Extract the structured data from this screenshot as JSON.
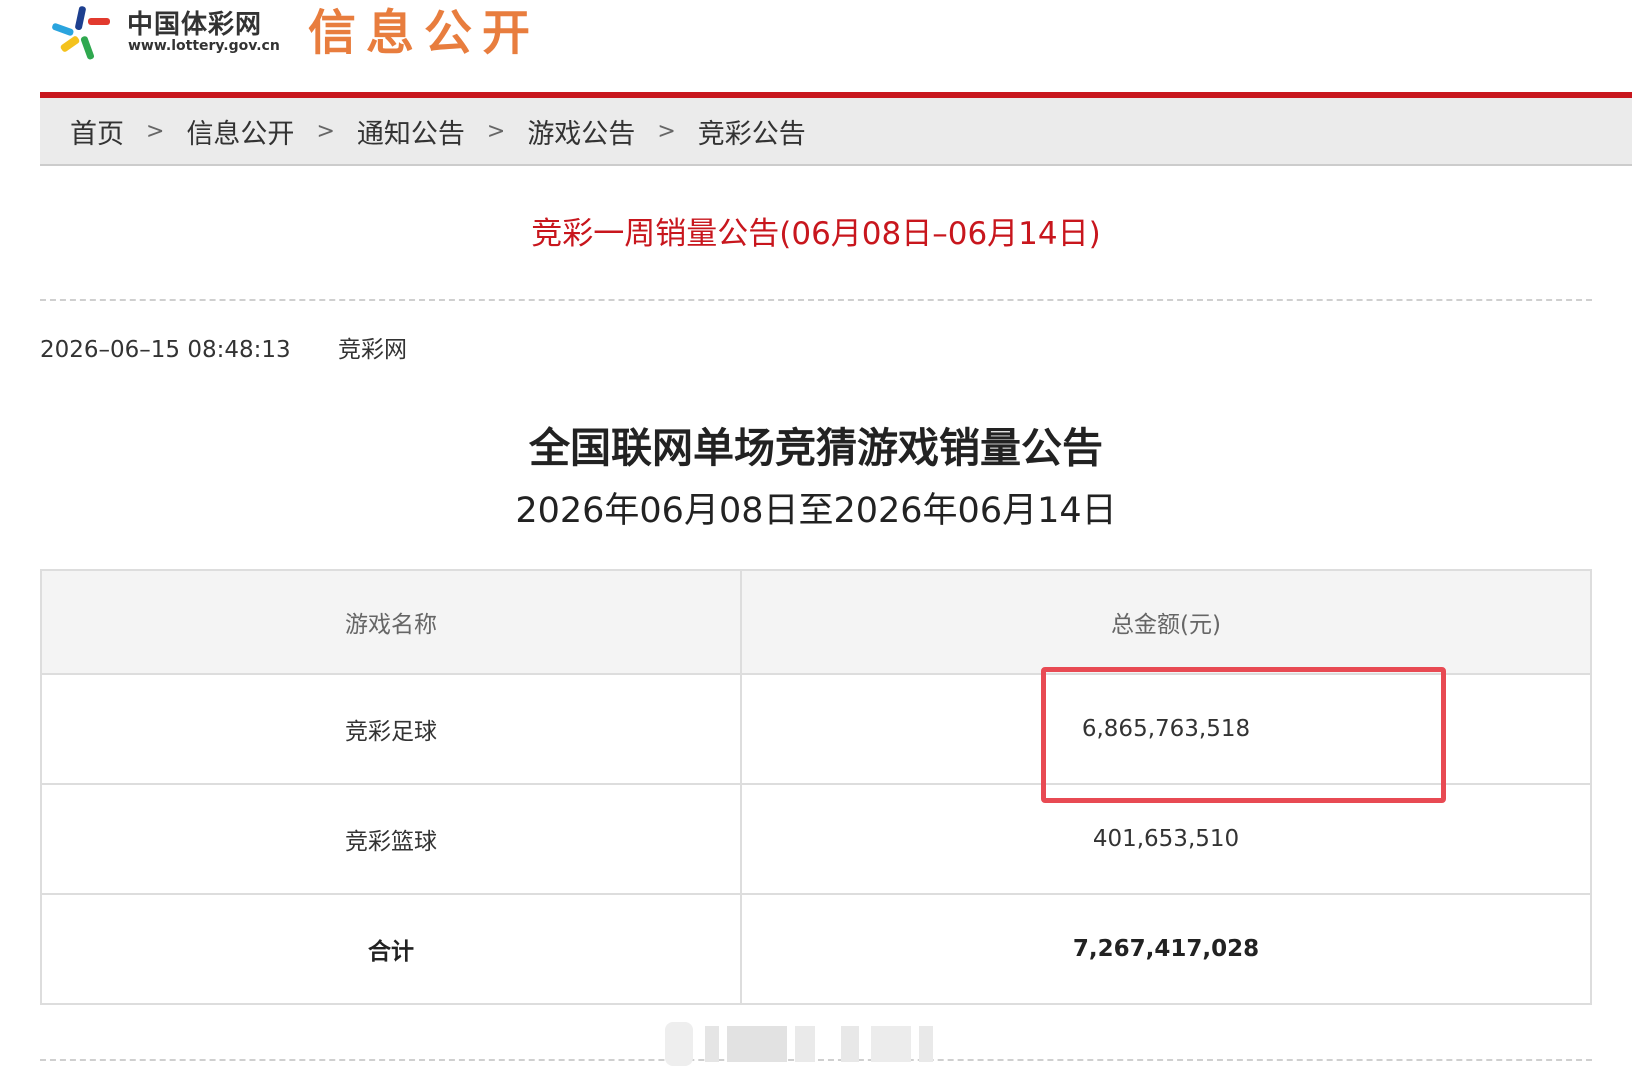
{
  "header": {
    "logo_cn": "中国体彩网",
    "logo_url": "www.lottery.gov.cn",
    "section_title": "信息公开"
  },
  "breadcrumb": {
    "items": [
      "首页",
      "信息公开",
      "通知公告",
      "游戏公告",
      "竞彩公告"
    ],
    "separator": ">"
  },
  "article": {
    "title": "竞彩一周销量公告(06月08日–06月14日)",
    "datetime": "2026–06–15 08:48:13",
    "source": "竞彩网",
    "heading": "全国联网单场竞猜游戏销量公告",
    "subheading": "2026年06月08日至2026年06月14日"
  },
  "table": {
    "headers": [
      "游戏名称",
      "总金额(元)"
    ],
    "rows": [
      {
        "name": "竞彩足球",
        "amount": "6,865,763,518"
      },
      {
        "name": "竞彩篮球",
        "amount": "401,653,510"
      }
    ],
    "total": {
      "name": "合计",
      "amount": "7,267,417,028"
    }
  },
  "colors": {
    "brand_red": "#c8161d",
    "section_orange": "#e87d3e",
    "highlight_box": "#e84a53"
  }
}
